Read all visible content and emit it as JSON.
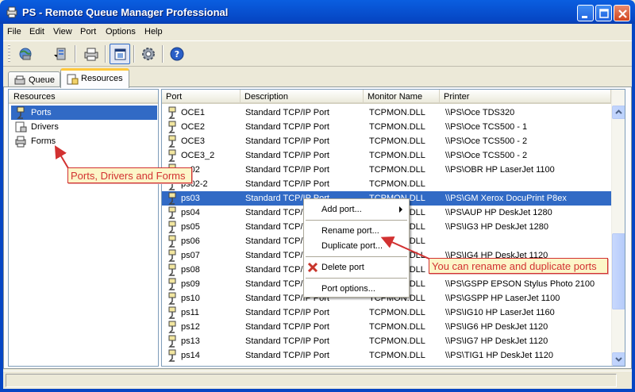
{
  "window": {
    "title": "PS - Remote Queue Manager Professional",
    "colors": {
      "titlebar": "#0a5ee0",
      "selection": "#316ac5",
      "callout_border": "#d23131",
      "callout_bg": "#fcf6c8"
    }
  },
  "menu": [
    "File",
    "Edit",
    "View",
    "Port",
    "Options",
    "Help"
  ],
  "toolbar": {
    "icons": [
      "globe-dropdown-icon",
      "server-icon",
      "printer-icon",
      "window-view-icon",
      "gear-icon",
      "help-icon"
    ]
  },
  "tabs": [
    {
      "label": "Queue"
    },
    {
      "label": "Resources"
    }
  ],
  "tree": {
    "header": "Resources",
    "items": [
      {
        "label": "Ports",
        "selected": true
      },
      {
        "label": "Drivers",
        "selected": false
      },
      {
        "label": "Forms",
        "selected": false
      }
    ]
  },
  "list": {
    "columns": [
      "Port",
      "Description",
      "Monitor Name",
      "Printer"
    ],
    "rows": [
      {
        "port": "OCE1",
        "description": "Standard TCP/IP Port",
        "monitor": "TCPMON.DLL",
        "printer": "\\\\PS\\Oce TDS320"
      },
      {
        "port": "OCE2",
        "description": "Standard TCP/IP Port",
        "monitor": "TCPMON.DLL",
        "printer": "\\\\PS\\Oce TCS500 - 1"
      },
      {
        "port": "OCE3",
        "description": "Standard TCP/IP Port",
        "monitor": "TCPMON.DLL",
        "printer": "\\\\PS\\Oce TCS500 - 2"
      },
      {
        "port": "OCE3_2",
        "description": "Standard TCP/IP Port",
        "monitor": "TCPMON.DLL",
        "printer": "\\\\PS\\Oce TCS500 - 2"
      },
      {
        "port": "ps02",
        "description": "Standard TCP/IP Port",
        "monitor": "TCPMON.DLL",
        "printer": "\\\\PS\\OBR HP LaserJet 1100"
      },
      {
        "port": "ps02-2",
        "description": "Standard TCP/IP Port",
        "monitor": "TCPMON.DLL",
        "printer": ""
      },
      {
        "port": "ps03",
        "description": "Standard TCP/IP Port",
        "monitor": "TCPMON.DLL",
        "printer": "\\\\PS\\GM Xerox DocuPrint P8ex",
        "selected": true
      },
      {
        "port": "ps04",
        "description": "Standard TCP/IP Port",
        "monitor": "TCPMON.DLL",
        "printer": "\\\\PS\\AUP HP DeskJet 1280"
      },
      {
        "port": "ps05",
        "description": "Standard TCP/IP Port",
        "monitor": "TCPMON.DLL",
        "printer": "\\\\PS\\IG3 HP DeskJet 1280"
      },
      {
        "port": "ps06",
        "description": "Standard TCP/IP Port",
        "monitor": "TCPMON.DLL",
        "printer": ""
      },
      {
        "port": "ps07",
        "description": "Standard TCP/IP Port",
        "monitor": "TCPMON.DLL",
        "printer": "\\\\PS\\IG4 HP DeskJet 1120"
      },
      {
        "port": "ps08",
        "description": "Standard TCP/IP Port",
        "monitor": "TCPMON.DLL",
        "printer": ""
      },
      {
        "port": "ps09",
        "description": "Standard TCP/IP Port",
        "monitor": "TCPMON.DLL",
        "printer": "\\\\PS\\GSPP EPSON Stylus Photo 2100"
      },
      {
        "port": "ps10",
        "description": "Standard TCP/IP Port",
        "monitor": "TCPMON.DLL",
        "printer": "\\\\PS\\GSPP HP LaserJet 1100"
      },
      {
        "port": "ps11",
        "description": "Standard TCP/IP Port",
        "monitor": "TCPMON.DLL",
        "printer": "\\\\PS\\IG10 HP LaserJet 1160"
      },
      {
        "port": "ps12",
        "description": "Standard TCP/IP Port",
        "monitor": "TCPMON.DLL",
        "printer": "\\\\PS\\IG6 HP DeskJet 1120"
      },
      {
        "port": "ps13",
        "description": "Standard TCP/IP Port",
        "monitor": "TCPMON.DLL",
        "printer": "\\\\PS\\IG7 HP DeskJet 1120"
      },
      {
        "port": "ps14",
        "description": "Standard TCP/IP Port",
        "monitor": "TCPMON.DLL",
        "printer": "\\\\PS\\TIG1 HP DeskJet 1120"
      }
    ]
  },
  "context_menu": {
    "items": [
      {
        "label": "Add port...",
        "submenu": true
      },
      {
        "label": "Rename port..."
      },
      {
        "label": "Duplicate port..."
      },
      {
        "label": "Delete port",
        "icon": "red-x-icon"
      },
      {
        "label": "Port options..."
      }
    ]
  },
  "callouts": {
    "left": "Ports, Drivers and Forms",
    "right": "You can rename and duplicate ports"
  }
}
